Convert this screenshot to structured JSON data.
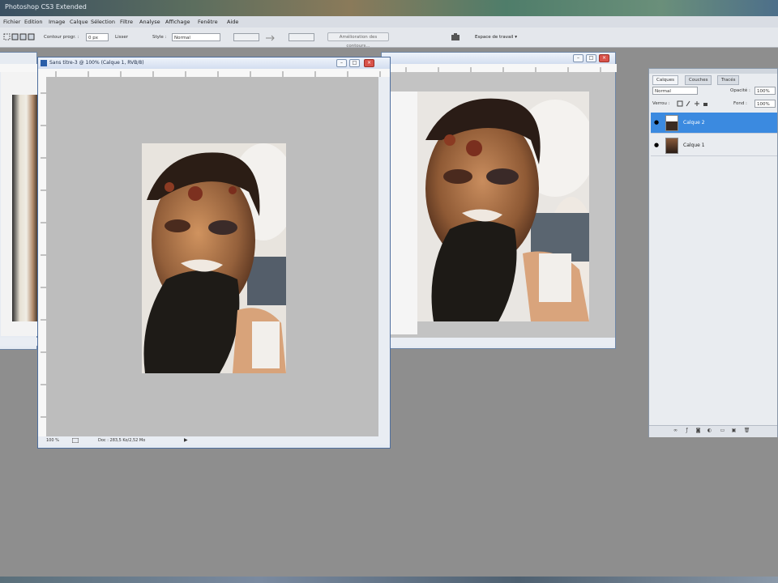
{
  "app": {
    "title": "Photoshop CS3 Extended"
  },
  "menu": [
    "Fichier",
    "Edition",
    "Image",
    "Calque",
    "Sélection",
    "Filtre",
    "Analyse",
    "Affichage",
    "Fenêtre",
    "Aide"
  ],
  "options": {
    "feather_label": "Contour progr. :",
    "feather_value": "0 px",
    "antialias_label": "Lisser",
    "style_label": "Style :",
    "style_value": "Normal",
    "refine_button": "Amélioration des contours...",
    "workspace_label": "Espace de travail ▾"
  },
  "doc_front": {
    "title": "Sans titre-3 @ 100% (Calque 1, RVB/8)",
    "zoom": "100 %",
    "info": "Doc : 283,5 Ko/2,52 Mo"
  },
  "layers_panel": {
    "tabs": [
      "Calques",
      "Couches",
      "Tracés"
    ],
    "blend_mode": "Normal",
    "opacity_label": "Opacité :",
    "opacity_value": "100%",
    "lock_label": "Verrou :",
    "fill_label": "Fond :",
    "fill_value": "100%",
    "layers": [
      {
        "name": "Calque 2",
        "selected": true
      },
      {
        "name": "Calque 1",
        "selected": false
      }
    ]
  },
  "colors": {
    "accent_selected": "#3b8ae0",
    "workspace": "#8e8e8e",
    "close_button": "#d9534a"
  }
}
